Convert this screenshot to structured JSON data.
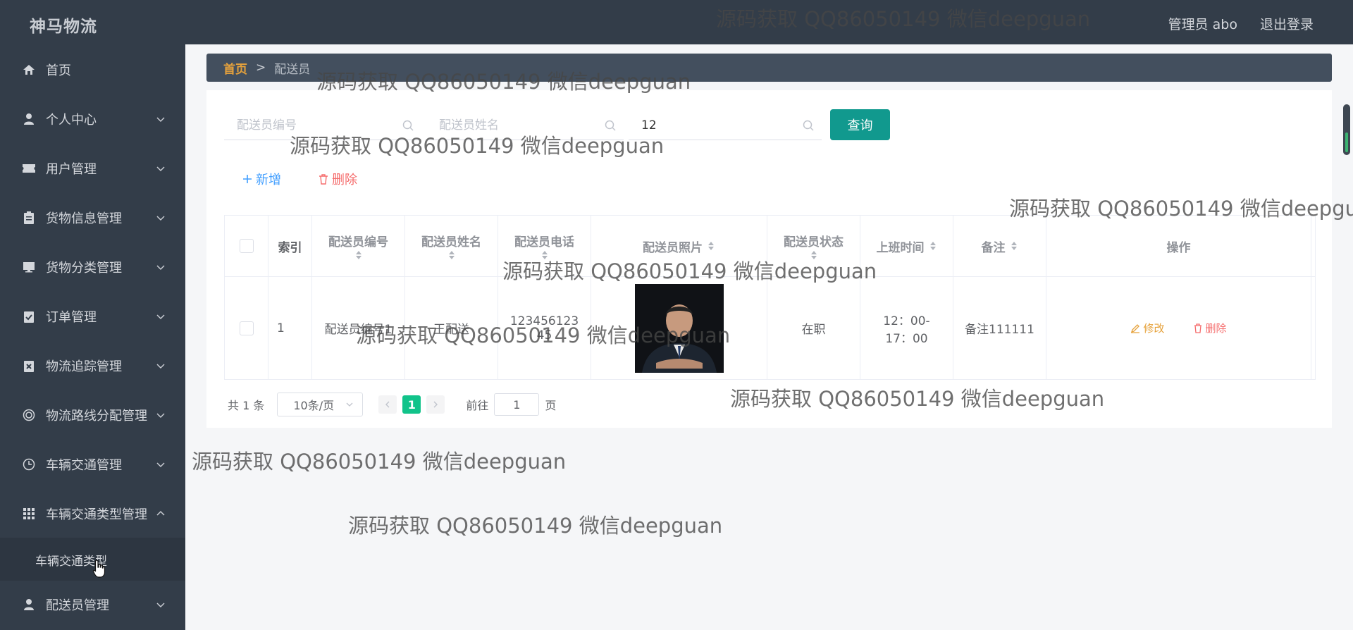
{
  "header": {
    "brand": "神马物流",
    "user_label": "管理员 abo",
    "logout_label": "退出登录"
  },
  "sidebar": {
    "items": [
      {
        "label": "首页",
        "icon": "home-icon"
      },
      {
        "label": "个人中心",
        "icon": "user-icon"
      },
      {
        "label": "用户管理",
        "icon": "ticket-icon"
      },
      {
        "label": "货物信息管理",
        "icon": "clipboard-icon"
      },
      {
        "label": "货物分类管理",
        "icon": "monitor-icon"
      },
      {
        "label": "订单管理",
        "icon": "checklist-icon"
      },
      {
        "label": "物流追踪管理",
        "icon": "close-doc-icon"
      },
      {
        "label": "物流路线分配管理",
        "icon": "ring-icon"
      },
      {
        "label": "车辆交通管理",
        "icon": "clock-icon"
      },
      {
        "label": "车辆交通类型管理",
        "icon": "grid-icon"
      },
      {
        "label": "配送员管理",
        "icon": "user-icon"
      }
    ],
    "submenu_item": "车辆交通类型"
  },
  "breadcrumb": {
    "home": "首页",
    "separator": ">",
    "current": "配送员"
  },
  "search": {
    "id_placeholder": "配送员编号",
    "name_placeholder": "配送员姓名",
    "phone_value": "12",
    "query_label": "查询"
  },
  "actions": {
    "add_label": "新增",
    "delete_label": "删除"
  },
  "table": {
    "headers": {
      "index": "索引",
      "courier_id": "配送员编号",
      "courier_name": "配送员姓名",
      "courier_phone": "配送员电话",
      "courier_photo": "配送员照片",
      "courier_status": "配送员状态",
      "work_time": "上班时间",
      "remark": "备注",
      "operation": "操作"
    },
    "rows": [
      {
        "index": "1",
        "courier_id": "配送员编号1",
        "courier_name": "王配送",
        "courier_phone": "12345612345",
        "status": "在职",
        "work_time": "12：00-17：00",
        "remark": "备注111111",
        "edit_label": "修改",
        "delete_label": "删除"
      }
    ]
  },
  "pagination": {
    "total": "共 1 条",
    "page_size": "10条/页",
    "current_page": "1",
    "goto_prefix": "前往",
    "goto_value": "1",
    "goto_suffix": "页"
  },
  "watermark": "源码获取 QQ86050149 微信deepguan",
  "colors": {
    "sidebar_bg": "#333d49",
    "accent": "#11998e",
    "page_active": "#11c38a",
    "breadcrumb_home": "#e6a23c",
    "danger": "#f56c6c",
    "primary": "#409eff"
  }
}
